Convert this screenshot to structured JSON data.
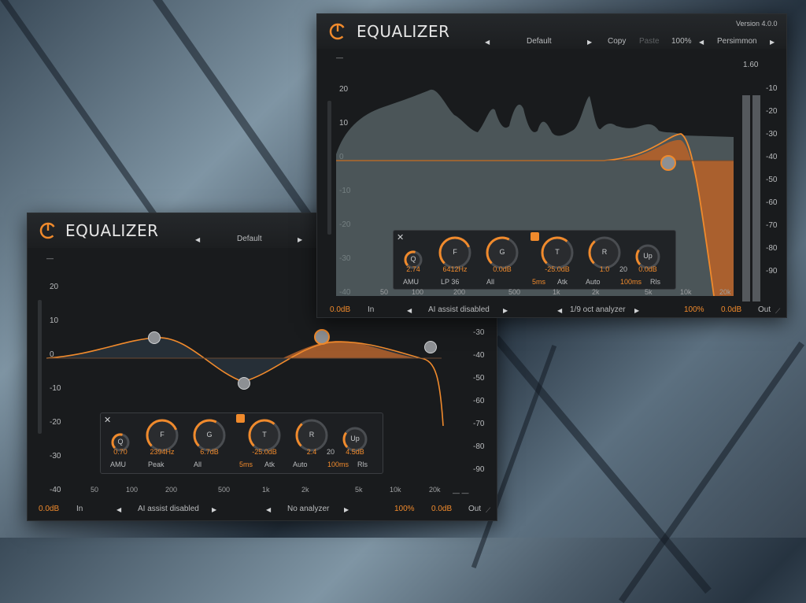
{
  "back": {
    "title": "EQUALIZER",
    "preset": "Default",
    "db_left": [
      "20",
      "10",
      "0",
      "-10",
      "-20",
      "-30",
      "-40"
    ],
    "db_right": [
      "-30",
      "-40",
      "-50",
      "-60",
      "-70",
      "-80",
      "-90"
    ],
    "freqs": [
      "50",
      "100",
      "200",
      "500",
      "1k",
      "2k",
      "5k",
      "10k",
      "20k"
    ],
    "panel": {
      "q_label": "Q",
      "q_val": "0.70",
      "f_label": "F",
      "f_val": "2394Hz",
      "g_label": "G",
      "g_val": "6.7dB",
      "t_label": "T",
      "t_val": "-25.0dB",
      "r_label": "R",
      "r_val": "2.4",
      "r_val2": "20",
      "up_label": "Up",
      "up_val": "4.5dB",
      "mode": "AMU",
      "filter": "Peak",
      "channel": "All",
      "atk_val": "5ms",
      "atk_label": "Atk",
      "auto_label": "Auto",
      "rls_val": "100ms",
      "rls_label": "Rls"
    },
    "footer": {
      "in_gain": "0.0dB",
      "in_label": "In",
      "ai": "AI assist disabled",
      "analyzer": "No analyzer",
      "mix": "100%",
      "out_gain": "0.0dB",
      "out_label": "Out"
    }
  },
  "front": {
    "title": "EQUALIZER",
    "version": "Version 4.0.0",
    "preset": "Default",
    "copy": "Copy",
    "paste": "Paste",
    "zoom": "100%",
    "theme": "Persimmon",
    "db_left": [
      "20",
      "10",
      "0",
      "-10",
      "-20",
      "-30",
      "-40"
    ],
    "db_right": [
      "-10",
      "-20",
      "-30",
      "-40",
      "-50",
      "-60",
      "-70",
      "-80",
      "-90"
    ],
    "meter_peak": "1.60",
    "freqs": [
      "50",
      "100",
      "200",
      "500",
      "1k",
      "2k",
      "5k",
      "10k",
      "20k"
    ],
    "panel": {
      "q_label": "Q",
      "q_val": "2.74",
      "f_label": "F",
      "f_val": "6412Hz",
      "g_label": "G",
      "g_val": "0.0dB",
      "t_label": "T",
      "t_val": "-25.0dB",
      "r_label": "R",
      "r_val": "1.0",
      "r_val2": "20",
      "up_label": "Up",
      "up_val": "0.0dB",
      "mode": "AMU",
      "filter": "LP 36",
      "channel": "All",
      "atk_val": "5ms",
      "atk_label": "Atk",
      "auto_label": "Auto",
      "rls_val": "100ms",
      "rls_label": "Rls"
    },
    "footer": {
      "in_gain": "0.0dB",
      "in_label": "In",
      "ai": "AI assist disabled",
      "analyzer": "1/9 oct analyzer",
      "mix": "100%",
      "out_gain": "0.0dB",
      "out_label": "Out"
    }
  },
  "colors": {
    "accent": "#f08a2c",
    "bg": "#191b1d"
  }
}
